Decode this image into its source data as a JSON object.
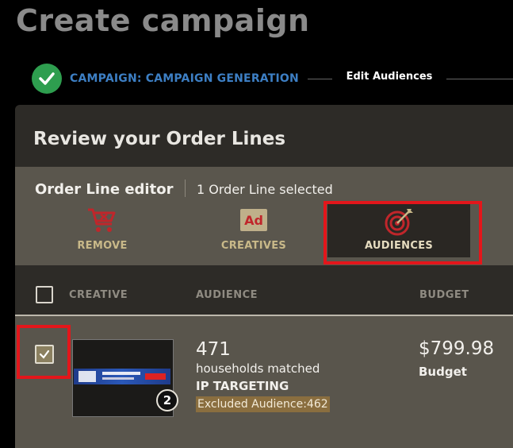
{
  "page": {
    "title": "Create campaign"
  },
  "stepper": {
    "label": "CAMPAIGN: CAMPAIGN GENERATION",
    "status_color": "#2e9e4f"
  },
  "card": {
    "title": "Review your Order Lines"
  },
  "editor": {
    "title": "Order Line editor",
    "selected_text": "1 Order Line selected",
    "actions": [
      {
        "label": "REMOVE",
        "icon": "cart-remove-icon"
      },
      {
        "label": "CREATIVES",
        "icon": "ad-icon"
      },
      {
        "label": "AUDIENCES",
        "icon": "target-icon"
      }
    ],
    "tooltip": "Edit Audiences"
  },
  "table": {
    "headers": [
      "CREATIVE",
      "AUDIENCE",
      "BUDGET"
    ],
    "rows": [
      {
        "selected": true,
        "creative_badge": "2",
        "audience_count": "471",
        "audience_matched": "households matched",
        "targeting": "IP TARGETING",
        "excluded": "Excluded Audience:462",
        "budget_value": "$799.98",
        "budget_label": "Budget"
      }
    ]
  },
  "colors": {
    "accent_red": "#e3161b",
    "gold": "#c9b989",
    "link_blue": "#3d7fc4"
  }
}
